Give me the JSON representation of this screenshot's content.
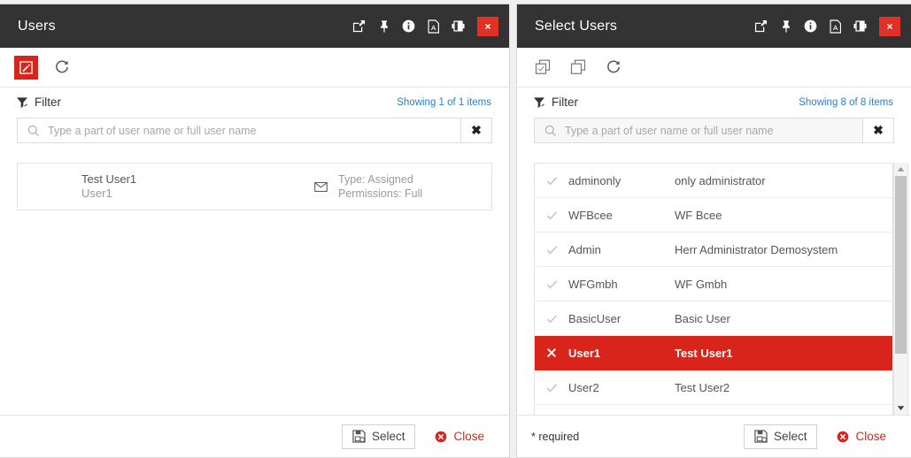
{
  "theme": {
    "titlebar_bg": "#333333",
    "accent_red": "#d9241c",
    "close_red": "#e03127",
    "link_blue": "#2a7fc9"
  },
  "left_panel": {
    "title": "Users",
    "titlebar_icons": [
      {
        "name": "popout-icon",
        "label": "Open in new window"
      },
      {
        "name": "pin-icon",
        "label": "Pin"
      },
      {
        "name": "info-icon",
        "label": "Info"
      },
      {
        "name": "pdf-icon",
        "label": "Export PDF"
      },
      {
        "name": "split-view-icon",
        "label": "Split view"
      }
    ],
    "close_label": "×",
    "toolbar": [
      {
        "name": "edit-button",
        "icon": "edit-box-icon",
        "primary": true
      },
      {
        "name": "refresh-button",
        "icon": "refresh-icon",
        "primary": false
      }
    ],
    "filter": {
      "label": "Filter",
      "showing": "Showing 1 of 1 items",
      "placeholder": "Type a part of user name or full user name",
      "value": "",
      "clear_label": "✖"
    },
    "user_card": {
      "name": "Test User1",
      "sub": "User1",
      "type": "Type: Assigned",
      "permissions": "Permissions: Full"
    },
    "footer": {
      "select_label": "Select",
      "close_label": "Close"
    }
  },
  "right_panel": {
    "title": "Select Users",
    "titlebar_icons": [
      {
        "name": "popout-icon",
        "label": "Open in new window"
      },
      {
        "name": "pin-icon",
        "label": "Pin"
      },
      {
        "name": "info-icon",
        "label": "Info"
      },
      {
        "name": "pdf-icon",
        "label": "Export PDF"
      },
      {
        "name": "split-view-icon",
        "label": "Split view"
      }
    ],
    "close_label": "×",
    "toolbar": [
      {
        "name": "select-all-button",
        "icon": "select-all-icon"
      },
      {
        "name": "deselect-all-button",
        "icon": "deselect-all-icon"
      },
      {
        "name": "refresh-button",
        "icon": "refresh-icon"
      }
    ],
    "filter": {
      "label": "Filter",
      "showing": "Showing 8 of 8 items",
      "placeholder": "Type a part of user name or full user name",
      "value": "",
      "clear_label": "✖"
    },
    "list": [
      {
        "user": "adminonly",
        "desc": "only administrator",
        "selected": false
      },
      {
        "user": "WFBcee",
        "desc": "WF Bcee",
        "selected": false
      },
      {
        "user": "Admin",
        "desc": "Herr Administrator Demosystem",
        "selected": false
      },
      {
        "user": "WFGmbh",
        "desc": "WF Gmbh",
        "selected": false
      },
      {
        "user": "BasicUser",
        "desc": "Basic User",
        "selected": false
      },
      {
        "user": "User1",
        "desc": "Test User1",
        "selected": true
      },
      {
        "user": "User2",
        "desc": "Test User2",
        "selected": false
      }
    ],
    "scrollbar": {
      "thumb_percent": 79
    },
    "footer": {
      "required_note": "* required",
      "select_label": "Select",
      "close_label": "Close"
    }
  }
}
